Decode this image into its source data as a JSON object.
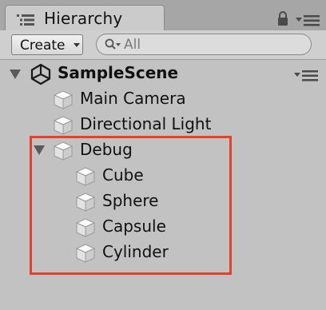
{
  "window": {
    "title": "Hierarchy"
  },
  "toolbar": {
    "create_label": "Create",
    "search_placeholder": "All"
  },
  "icons": {
    "tab": "hierarchy-list-icon",
    "lock": "lock-icon",
    "window_menu": "window-menu-icon",
    "search": "search-icon",
    "scene": "unity-logo-icon",
    "gameobject": "cube-icon"
  },
  "colors": {
    "selection_frame": "#e0432d",
    "panel_bg": "#c2c2c2"
  },
  "hierarchy": {
    "scene_name": "SampleScene",
    "items": [
      {
        "label": "Main Camera",
        "depth": 1
      },
      {
        "label": "Directional Light",
        "depth": 1
      },
      {
        "label": "Debug",
        "depth": 1,
        "expanded": true
      },
      {
        "label": "Cube",
        "depth": 2
      },
      {
        "label": "Sphere",
        "depth": 2
      },
      {
        "label": "Capsule",
        "depth": 2
      },
      {
        "label": "Cylinder",
        "depth": 2
      }
    ]
  }
}
